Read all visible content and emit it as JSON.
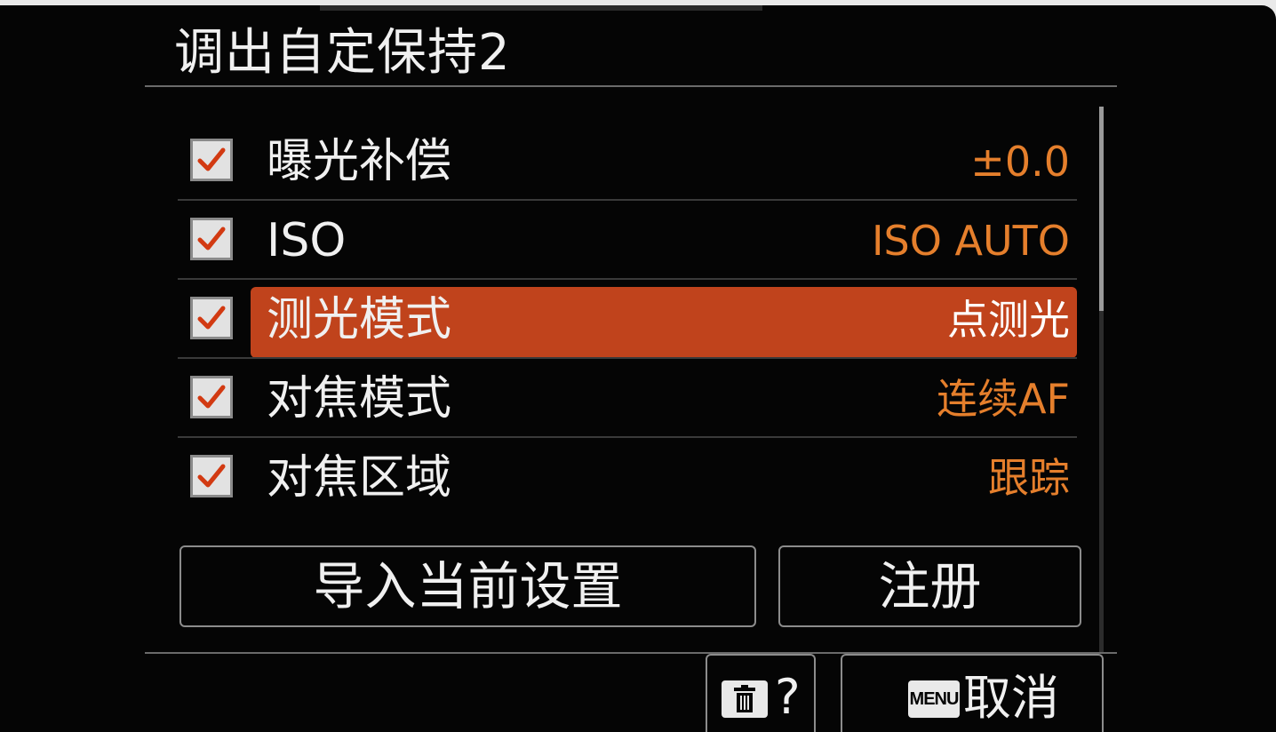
{
  "title": "调出自定保持2",
  "colors": {
    "accent": "#c0431c",
    "value_text": "#e57f2c",
    "background": "#050505"
  },
  "items": [
    {
      "label": "曝光补偿",
      "value": "±0.0",
      "checked": true,
      "selected": false
    },
    {
      "label": "ISO",
      "value": "ISO AUTO",
      "checked": true,
      "selected": false
    },
    {
      "label": "测光模式",
      "value": "点测光",
      "checked": true,
      "selected": true
    },
    {
      "label": "对焦模式",
      "value": "连续AF",
      "checked": true,
      "selected": false
    },
    {
      "label": "对焦区域",
      "value": "跟踪",
      "checked": true,
      "selected": false
    }
  ],
  "buttons": {
    "import_label": "导入当前设置",
    "register_label": "注册"
  },
  "footer": {
    "help_icon": "trash-icon",
    "help_label": "?",
    "menu_badge": "MENU",
    "cancel_label": "取消"
  }
}
